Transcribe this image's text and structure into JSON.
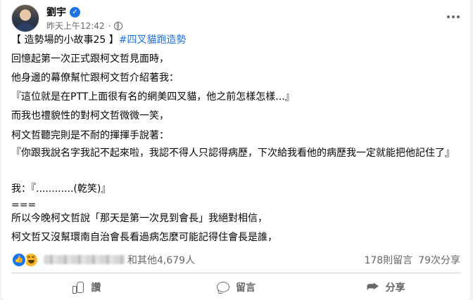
{
  "post": {
    "author": "劉宇",
    "timestamp": "昨天上午12:42",
    "lines": [
      "【 造勢場的小故事25 】",
      "回憶起第一次正式跟柯文哲見面時，",
      "他身邊的幕僚幫忙跟柯文哲介紹著我：",
      "『這位就是在PTT上面很有名的網美四叉貓，他之前怎樣怎樣...』",
      "而我也禮貌性的對柯文哲微微一笑，",
      "柯文哲聽完則是不耐的揮揮手說著：",
      "『你跟我說名字我記不起來啦，我認不得人只認得病歷，下次給我看他的病歷我一定就能把他記住了』",
      "我：『............(乾笑)』",
      "===",
      "所以今晚柯文哲說「那天是第一次見到會長」我絕對相信，",
      "柯文哲又沒幫環南自治會長看過病怎麼可能記得住會長是誰，"
    ],
    "hashtag": "#四叉貓跑造勢"
  },
  "reactions": {
    "others_text": "和其他4,679人",
    "comments": "178則留言",
    "shares": "79次分享"
  },
  "actions": {
    "like": "讚",
    "comment": "留言",
    "share": "分享"
  },
  "icons": [
    "verified-badge-icon",
    "globe-icon",
    "more-options-icon",
    "like-reaction-icon",
    "haha-reaction-icon",
    "like-icon",
    "comment-icon",
    "share-icon"
  ],
  "colors": {
    "accent": "#1877f2",
    "hashtag": "#216fdb",
    "secondary_text": "#65676b"
  }
}
